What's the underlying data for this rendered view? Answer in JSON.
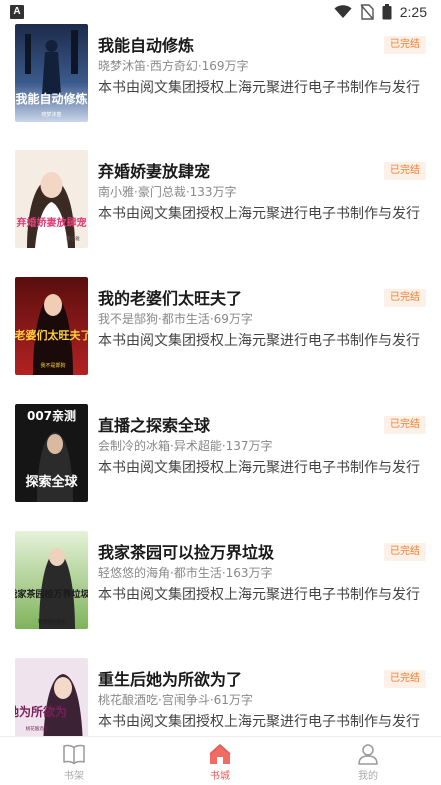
{
  "status_bar": {
    "left_icon_letter": "A",
    "time": "2:25"
  },
  "books": [
    {
      "title": "我能自动修炼",
      "meta": "晓梦沐笛·西方奇幻·169万字",
      "desc": "本书由阅文集团授权上海元聚进行电子书制作与发行",
      "status": "已完结",
      "cover_text": "我能自动修炼",
      "cover_small": "晓梦沐笛",
      "cover_theme": "#2d3f6b"
    },
    {
      "title": "弃婚娇妻放肆宠",
      "meta": "南小雅·豪门总裁·133万字",
      "desc": "本书由阅文集团授权上海元聚进行电子书制作与发行",
      "status": "已完结",
      "cover_text": "弃婚娇妻放肆宠",
      "cover_small": "南小雅",
      "cover_theme": "#f3e6dc"
    },
    {
      "title": "我的老婆们太旺夫了",
      "meta": "我不是郜狗·都市生活·69万字",
      "desc": "本书由阅文集团授权上海元聚进行电子书制作与发行",
      "status": "已完结",
      "cover_text": "老婆们太旺夫了",
      "cover_small": "我不是郜狗",
      "cover_theme": "#8b1a1a"
    },
    {
      "title": "直播之探索全球",
      "meta": "会制冷的冰箱·异术超能·137万字",
      "desc": "本书由阅文集团授权上海元聚进行电子书制作与发行",
      "status": "已完结",
      "cover_text": "探索全球",
      "cover_small": "007亲测",
      "cover_theme": "#1b1b1b"
    },
    {
      "title": "我家茶园可以捡万界垃圾",
      "meta": "轻悠悠的海角·都市生活·163万字",
      "desc": "本书由阅文集团授权上海元聚进行电子书制作与发行",
      "status": "已完结",
      "cover_text": "我家茶园捡万界垃圾",
      "cover_small": "轻悠悠的海角",
      "cover_theme": "#9cc97a"
    },
    {
      "title": "重生后她为所欲为了",
      "meta": "桃花酿酒吃·宫闱争斗·61万字",
      "desc": "本书由阅文集团授权上海元聚进行电子书制作与发行",
      "status": "已完结",
      "cover_text": "她为所欲为",
      "cover_small": "桃花酿酒吃",
      "cover_theme": "#e9d7e6"
    }
  ],
  "tabs": [
    {
      "label": "书架",
      "icon": "book-open-icon",
      "active": false
    },
    {
      "label": "书城",
      "icon": "home-icon",
      "active": true
    },
    {
      "label": "我的",
      "icon": "user-icon",
      "active": false
    }
  ],
  "colors": {
    "accent": "#e85c55",
    "badge_text": "#f07d2e",
    "badge_bg": "#fdf0e6"
  }
}
